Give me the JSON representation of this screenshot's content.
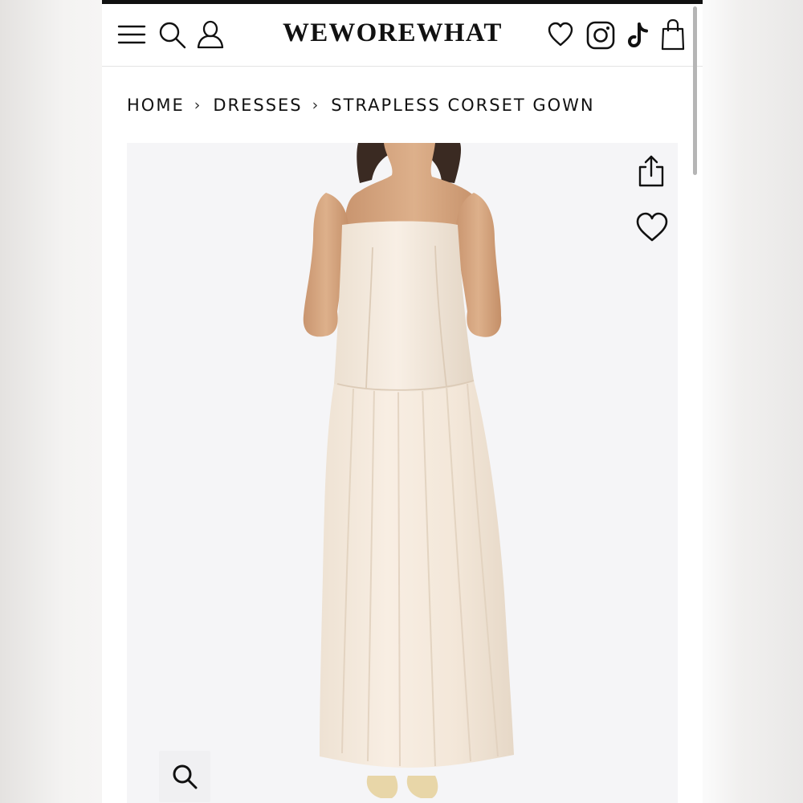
{
  "header": {
    "brand": "WEWOREWHAT",
    "icons": [
      "menu-icon",
      "search-icon",
      "account-icon",
      "wishlist-heart-icon",
      "instagram-icon",
      "tiktok-icon",
      "shopping-bag-icon"
    ]
  },
  "breadcrumb": {
    "items": [
      "HOME",
      "DRESSES",
      "STRAPLESS CORSET GOWN"
    ],
    "separator": "›"
  },
  "product_gallery": {
    "image": "product-photo",
    "actions": [
      "share-icon",
      "favorite-heart-icon",
      "zoom-icon"
    ]
  },
  "colors": {
    "text": "#111111",
    "gallery_background": "#f5f5f7",
    "dress": "#f6ece0"
  }
}
